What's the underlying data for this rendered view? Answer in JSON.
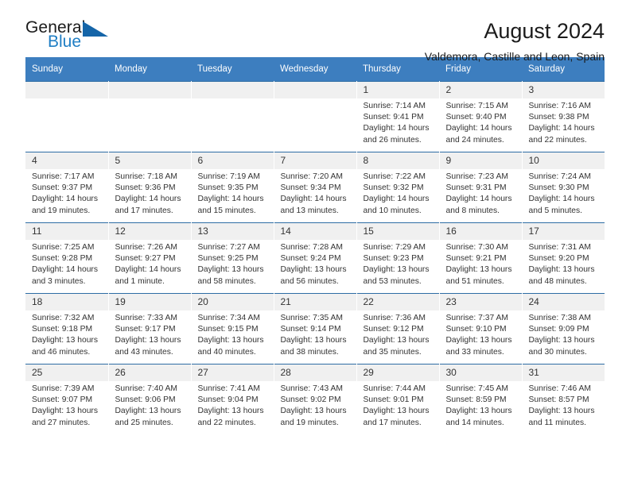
{
  "brand": {
    "name_part1": "General",
    "name_part2": "Blue",
    "triangle_icon": "triangle-icon",
    "accent_color": "#1f7ec4",
    "header_color": "#3d7ebf"
  },
  "header": {
    "title": "August 2024",
    "subtitle": "Valdemora, Castille and Leon, Spain"
  },
  "weekdays": [
    "Sunday",
    "Monday",
    "Tuesday",
    "Wednesday",
    "Thursday",
    "Friday",
    "Saturday"
  ],
  "labels": {
    "sunrise_prefix": "Sunrise:",
    "sunset_prefix": "Sunset:",
    "daylight_prefix": "Daylight:"
  },
  "weeks": [
    [
      {
        "day": "",
        "empty": true
      },
      {
        "day": "",
        "empty": true
      },
      {
        "day": "",
        "empty": true
      },
      {
        "day": "",
        "empty": true
      },
      {
        "day": "1",
        "sunrise": "Sunrise: 7:14 AM",
        "sunset": "Sunset: 9:41 PM",
        "daylight": "Daylight: 14 hours and 26 minutes."
      },
      {
        "day": "2",
        "sunrise": "Sunrise: 7:15 AM",
        "sunset": "Sunset: 9:40 PM",
        "daylight": "Daylight: 14 hours and 24 minutes."
      },
      {
        "day": "3",
        "sunrise": "Sunrise: 7:16 AM",
        "sunset": "Sunset: 9:38 PM",
        "daylight": "Daylight: 14 hours and 22 minutes."
      }
    ],
    [
      {
        "day": "4",
        "sunrise": "Sunrise: 7:17 AM",
        "sunset": "Sunset: 9:37 PM",
        "daylight": "Daylight: 14 hours and 19 minutes."
      },
      {
        "day": "5",
        "sunrise": "Sunrise: 7:18 AM",
        "sunset": "Sunset: 9:36 PM",
        "daylight": "Daylight: 14 hours and 17 minutes."
      },
      {
        "day": "6",
        "sunrise": "Sunrise: 7:19 AM",
        "sunset": "Sunset: 9:35 PM",
        "daylight": "Daylight: 14 hours and 15 minutes."
      },
      {
        "day": "7",
        "sunrise": "Sunrise: 7:20 AM",
        "sunset": "Sunset: 9:34 PM",
        "daylight": "Daylight: 14 hours and 13 minutes."
      },
      {
        "day": "8",
        "sunrise": "Sunrise: 7:22 AM",
        "sunset": "Sunset: 9:32 PM",
        "daylight": "Daylight: 14 hours and 10 minutes."
      },
      {
        "day": "9",
        "sunrise": "Sunrise: 7:23 AM",
        "sunset": "Sunset: 9:31 PM",
        "daylight": "Daylight: 14 hours and 8 minutes."
      },
      {
        "day": "10",
        "sunrise": "Sunrise: 7:24 AM",
        "sunset": "Sunset: 9:30 PM",
        "daylight": "Daylight: 14 hours and 5 minutes."
      }
    ],
    [
      {
        "day": "11",
        "sunrise": "Sunrise: 7:25 AM",
        "sunset": "Sunset: 9:28 PM",
        "daylight": "Daylight: 14 hours and 3 minutes."
      },
      {
        "day": "12",
        "sunrise": "Sunrise: 7:26 AM",
        "sunset": "Sunset: 9:27 PM",
        "daylight": "Daylight: 14 hours and 1 minute."
      },
      {
        "day": "13",
        "sunrise": "Sunrise: 7:27 AM",
        "sunset": "Sunset: 9:25 PM",
        "daylight": "Daylight: 13 hours and 58 minutes."
      },
      {
        "day": "14",
        "sunrise": "Sunrise: 7:28 AM",
        "sunset": "Sunset: 9:24 PM",
        "daylight": "Daylight: 13 hours and 56 minutes."
      },
      {
        "day": "15",
        "sunrise": "Sunrise: 7:29 AM",
        "sunset": "Sunset: 9:23 PM",
        "daylight": "Daylight: 13 hours and 53 minutes."
      },
      {
        "day": "16",
        "sunrise": "Sunrise: 7:30 AM",
        "sunset": "Sunset: 9:21 PM",
        "daylight": "Daylight: 13 hours and 51 minutes."
      },
      {
        "day": "17",
        "sunrise": "Sunrise: 7:31 AM",
        "sunset": "Sunset: 9:20 PM",
        "daylight": "Daylight: 13 hours and 48 minutes."
      }
    ],
    [
      {
        "day": "18",
        "sunrise": "Sunrise: 7:32 AM",
        "sunset": "Sunset: 9:18 PM",
        "daylight": "Daylight: 13 hours and 46 minutes."
      },
      {
        "day": "19",
        "sunrise": "Sunrise: 7:33 AM",
        "sunset": "Sunset: 9:17 PM",
        "daylight": "Daylight: 13 hours and 43 minutes."
      },
      {
        "day": "20",
        "sunrise": "Sunrise: 7:34 AM",
        "sunset": "Sunset: 9:15 PM",
        "daylight": "Daylight: 13 hours and 40 minutes."
      },
      {
        "day": "21",
        "sunrise": "Sunrise: 7:35 AM",
        "sunset": "Sunset: 9:14 PM",
        "daylight": "Daylight: 13 hours and 38 minutes."
      },
      {
        "day": "22",
        "sunrise": "Sunrise: 7:36 AM",
        "sunset": "Sunset: 9:12 PM",
        "daylight": "Daylight: 13 hours and 35 minutes."
      },
      {
        "day": "23",
        "sunrise": "Sunrise: 7:37 AM",
        "sunset": "Sunset: 9:10 PM",
        "daylight": "Daylight: 13 hours and 33 minutes."
      },
      {
        "day": "24",
        "sunrise": "Sunrise: 7:38 AM",
        "sunset": "Sunset: 9:09 PM",
        "daylight": "Daylight: 13 hours and 30 minutes."
      }
    ],
    [
      {
        "day": "25",
        "sunrise": "Sunrise: 7:39 AM",
        "sunset": "Sunset: 9:07 PM",
        "daylight": "Daylight: 13 hours and 27 minutes."
      },
      {
        "day": "26",
        "sunrise": "Sunrise: 7:40 AM",
        "sunset": "Sunset: 9:06 PM",
        "daylight": "Daylight: 13 hours and 25 minutes."
      },
      {
        "day": "27",
        "sunrise": "Sunrise: 7:41 AM",
        "sunset": "Sunset: 9:04 PM",
        "daylight": "Daylight: 13 hours and 22 minutes."
      },
      {
        "day": "28",
        "sunrise": "Sunrise: 7:43 AM",
        "sunset": "Sunset: 9:02 PM",
        "daylight": "Daylight: 13 hours and 19 minutes."
      },
      {
        "day": "29",
        "sunrise": "Sunrise: 7:44 AM",
        "sunset": "Sunset: 9:01 PM",
        "daylight": "Daylight: 13 hours and 17 minutes."
      },
      {
        "day": "30",
        "sunrise": "Sunrise: 7:45 AM",
        "sunset": "Sunset: 8:59 PM",
        "daylight": "Daylight: 13 hours and 14 minutes."
      },
      {
        "day": "31",
        "sunrise": "Sunrise: 7:46 AM",
        "sunset": "Sunset: 8:57 PM",
        "daylight": "Daylight: 13 hours and 11 minutes."
      }
    ]
  ]
}
